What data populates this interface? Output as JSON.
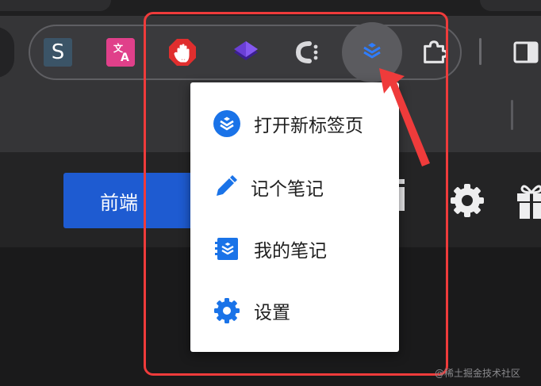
{
  "toolbar": {
    "extensions": [
      {
        "name": "s-extension",
        "glyph": "S"
      },
      {
        "name": "translate-extension",
        "glyph": "文A"
      },
      {
        "name": "adblock-extension",
        "glyph": "hand"
      },
      {
        "name": "layers-extension",
        "glyph": "layers"
      },
      {
        "name": "c-extension",
        "glyph": "C:"
      },
      {
        "name": "notes-extension",
        "glyph": "stack",
        "active": true
      },
      {
        "name": "extensions-puzzle",
        "glyph": "puzzle"
      }
    ]
  },
  "page": {
    "front_button_label": "前端"
  },
  "menu": {
    "items": [
      {
        "label": "打开新标签页",
        "icon": "stack-icon"
      },
      {
        "label": "记个笔记",
        "icon": "pencil-icon"
      },
      {
        "label": "我的笔记",
        "icon": "notebook-icon"
      },
      {
        "label": "设置",
        "icon": "gear-icon"
      }
    ]
  },
  "watermark": "@稀土掘金技术社区",
  "colors": {
    "accent_blue": "#1a73e8",
    "annotation_red": "#ef3b3b",
    "toolbar": "#353537",
    "page_button": "#1e5bd1"
  }
}
